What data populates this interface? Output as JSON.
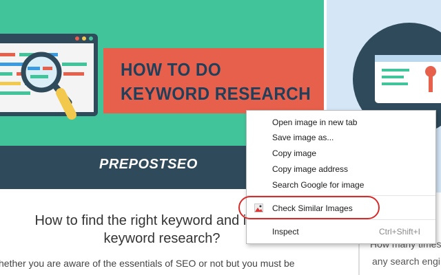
{
  "banner": {
    "headline_line1": "HOW TO DO",
    "headline_line2": "KEYWORD RESEARCH",
    "brand": "PREPOSTSEO",
    "colors": {
      "bg": "#41c49a",
      "footer": "#2e4a5b",
      "headline_bg": "#e7604c",
      "headline_text": "#1f3f5a"
    }
  },
  "article": {
    "title_line1": "How to find the right keyword and importa",
    "title_line2": "keyword research?",
    "excerpt": "hether you are aware of the essentials of SEO or not but you must be"
  },
  "right_article": {
    "excerpt_line1": "How many times",
    "excerpt_line2": "any search engi"
  },
  "context_menu": {
    "items": [
      {
        "label": "Open image in new tab",
        "shortcut": ""
      },
      {
        "label": "Save image as...",
        "shortcut": ""
      },
      {
        "label": "Copy image",
        "shortcut": ""
      },
      {
        "label": "Copy image address",
        "shortcut": ""
      },
      {
        "label": "Search Google for image",
        "shortcut": ""
      },
      {
        "label": "Check Similar Images",
        "shortcut": "",
        "icon": "extension-image-icon",
        "highlighted": true
      },
      {
        "label": "Inspect",
        "shortcut": "Ctrl+Shift+I"
      }
    ]
  }
}
